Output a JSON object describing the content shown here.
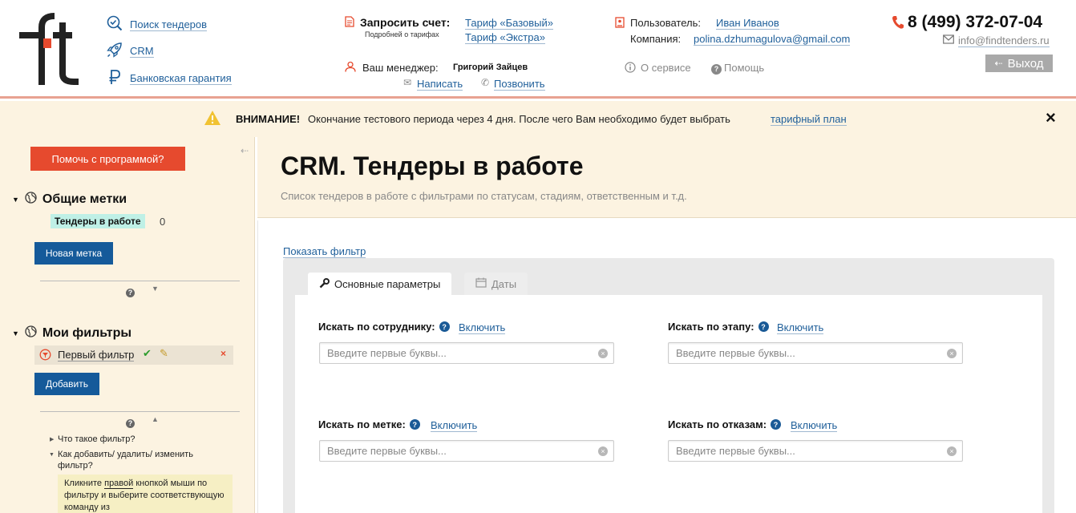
{
  "header": {
    "nav": [
      {
        "label": "Поиск тендеров",
        "icon": "search-icon"
      },
      {
        "label": "CRM",
        "icon": "rocket-icon"
      },
      {
        "label": "Банковская гарантия",
        "icon": "ruble-icon"
      }
    ],
    "invoice": {
      "title": "Запросить счет:",
      "sub": "Подробней о тарифах",
      "tariff1": "Тариф «Базовый»",
      "tariff2": "Тариф «Экстра»"
    },
    "manager": {
      "label": "Ваш менеджер:",
      "name": "Григорий Зайцев",
      "write": "Написать",
      "call": "Позвонить"
    },
    "user": {
      "user_label": "Пользователь:",
      "user_name": "Иван Иванов",
      "company_label": "Компания:",
      "company_value": "polina.dzhumagulova@gmail.com",
      "about": "О сервисе",
      "help": "Помощь"
    },
    "contact": {
      "phone": "8 (499) 372-07-04",
      "email": "info@findtenders.ru",
      "exit": "Выход"
    }
  },
  "banner": {
    "strong": "ВНИМАНИЕ!",
    "text": "Окончание тестового периода через 4 дня. После чего Вам необходимо будет выбрать",
    "link": "тарифный план",
    "close": "×"
  },
  "sidebar": {
    "help_button": "Помочь с программой?",
    "common_tags_title": "Общие метки",
    "tag_label": "Тендеры в работе",
    "tag_count": "0",
    "new_tag_button": "Новая метка",
    "my_filters_title": "Мои фильтры",
    "filter_name": "Первый фильтр",
    "add_button": "Добавить",
    "faq1": "Что такое фильтр?",
    "faq2": "Как добавить/ удалить/ изменить фильтр?",
    "faq_answer_1": "Кликните",
    "faq_answer_link": "правой",
    "faq_answer_2": "кнопкой мыши по фильтру и выберите соответствующую команду из"
  },
  "main": {
    "title": "CRM. Тендеры в работе",
    "subtitle": "Список тендеров в работе с фильтрами по статусам, стадиям, ответственным и т.д.",
    "show_filter": "Показать фильтр",
    "tabs": [
      "Основные параметры",
      "Даты"
    ],
    "fields": [
      {
        "label": "Искать по сотруднику:",
        "action": "Включить",
        "placeholder": "Введите первые буквы..."
      },
      {
        "label": "Искать по этапу:",
        "action": "Включить",
        "placeholder": "Введите первые буквы..."
      },
      {
        "label": "Искать по метке:",
        "action": "Включить",
        "placeholder": "Введите первые буквы..."
      },
      {
        "label": "Искать по отказам:",
        "action": "Включить",
        "placeholder": "Введите первые буквы..."
      }
    ]
  },
  "colors": {
    "accent_red": "#e64a2e",
    "accent_blue": "#155a9a",
    "banner_bg": "#fcf3e1"
  }
}
